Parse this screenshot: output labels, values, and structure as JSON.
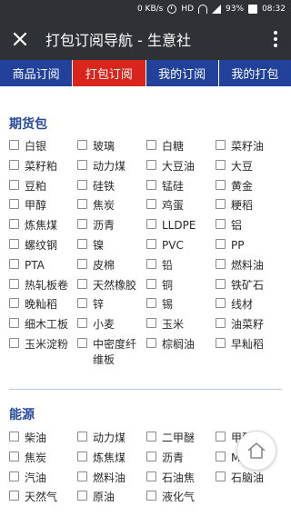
{
  "status_bar": {
    "speed": "0 KB/s",
    "hd": "HD",
    "battery": "93%",
    "time": "08:32"
  },
  "header": {
    "title": "打包订阅导航 - 生意社"
  },
  "tabs": [
    {
      "label": "商品订阅",
      "active": false
    },
    {
      "label": "打包订阅",
      "active": true
    },
    {
      "label": "我的订阅",
      "active": false
    },
    {
      "label": "我的打包",
      "active": false
    }
  ],
  "sections": [
    {
      "title": "期货包",
      "items": [
        "白银",
        "玻璃",
        "白糖",
        "菜籽油",
        "菜籽粕",
        "动力煤",
        "大豆油",
        "大豆",
        "豆粕",
        "硅铁",
        "锰硅",
        "黄金",
        "甲醇",
        "焦炭",
        "鸡蛋",
        "粳稻",
        "炼焦煤",
        "沥青",
        "LLDPE",
        "铝",
        "螺纹钢",
        "镍",
        "PVC",
        "PP",
        "PTA",
        "皮棉",
        "铅",
        "燃料油",
        "热轧板卷",
        "天然橡胶",
        "铜",
        "铁矿石",
        "晚籼稻",
        "锌",
        "锡",
        "线材",
        "细木工板",
        "小麦",
        "玉米",
        "油菜籽",
        "玉米淀粉",
        "中密度纤维板",
        "棕榈油",
        "早籼稻"
      ]
    },
    {
      "title": "能源",
      "items": [
        "柴油",
        "动力煤",
        "二甲醚",
        "甲醇",
        "焦炭",
        "炼焦煤",
        "沥青",
        "MTBE",
        "汽油",
        "燃料油",
        "石油焦",
        "石脑油",
        "天然气",
        "原油",
        "液化气"
      ]
    }
  ],
  "colors": {
    "header_bg": "#2e3136",
    "tab_bg": "#22419a",
    "tab_active": "#d9251c",
    "section_title": "#274a9c"
  },
  "icons": {
    "close": "close-icon",
    "more": "more-vertical-icon",
    "home": "home-icon"
  }
}
